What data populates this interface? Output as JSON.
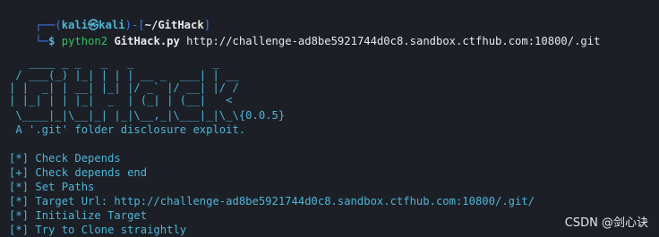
{
  "prompt": {
    "corner_top": "┌──(",
    "user": "kali",
    "at_symbol": "㉿",
    "host": "kali",
    "sep": ")-[",
    "path": "~/GitHack",
    "end": "]",
    "corner_bottom": "└─",
    "dollar": "$ ",
    "cmd": "python2",
    "script": "GitHack.py",
    "url": "http://challenge-ad8be5921744d0c8.sandbox.ctfhub.com:10800/.git"
  },
  "banner": {
    "lines": [
      "   ____ _ _   _   _            _",
      " / ___(_) |_| | | | __ _  ___| | __",
      "| |  _| | __| |_| |/ _` |/ __| |/ /",
      "| |_| | | |_|  _  | (_| | (__|   <",
      " \\____|_|\\__|_| |_|\\__,_|\\___|_|\\_\\{0.0.5}"
    ],
    "tagline": " A '.git' folder disclosure exploit."
  },
  "log": [
    {
      "tag": "[*]",
      "text": " Check Depends"
    },
    {
      "tag": "[+]",
      "text": " Check depends end"
    },
    {
      "tag": "[*]",
      "text": " Set Paths"
    },
    {
      "tag": "[*]",
      "text": " Target Url: http://challenge-ad8be5921744d0c8.sandbox.ctfhub.com:10800/.git/"
    },
    {
      "tag": "[*]",
      "text": " Initialize Target"
    },
    {
      "tag": "[*]",
      "text": " Try to Clone straightly"
    }
  ],
  "watermark": "CSDN @剑心诀",
  "colors": {
    "background": "#1c1f26",
    "prompt_frame": "#3d7be6",
    "accent": "#4fb5d6",
    "text": "#e8e8e8",
    "command": "#34c15f"
  }
}
